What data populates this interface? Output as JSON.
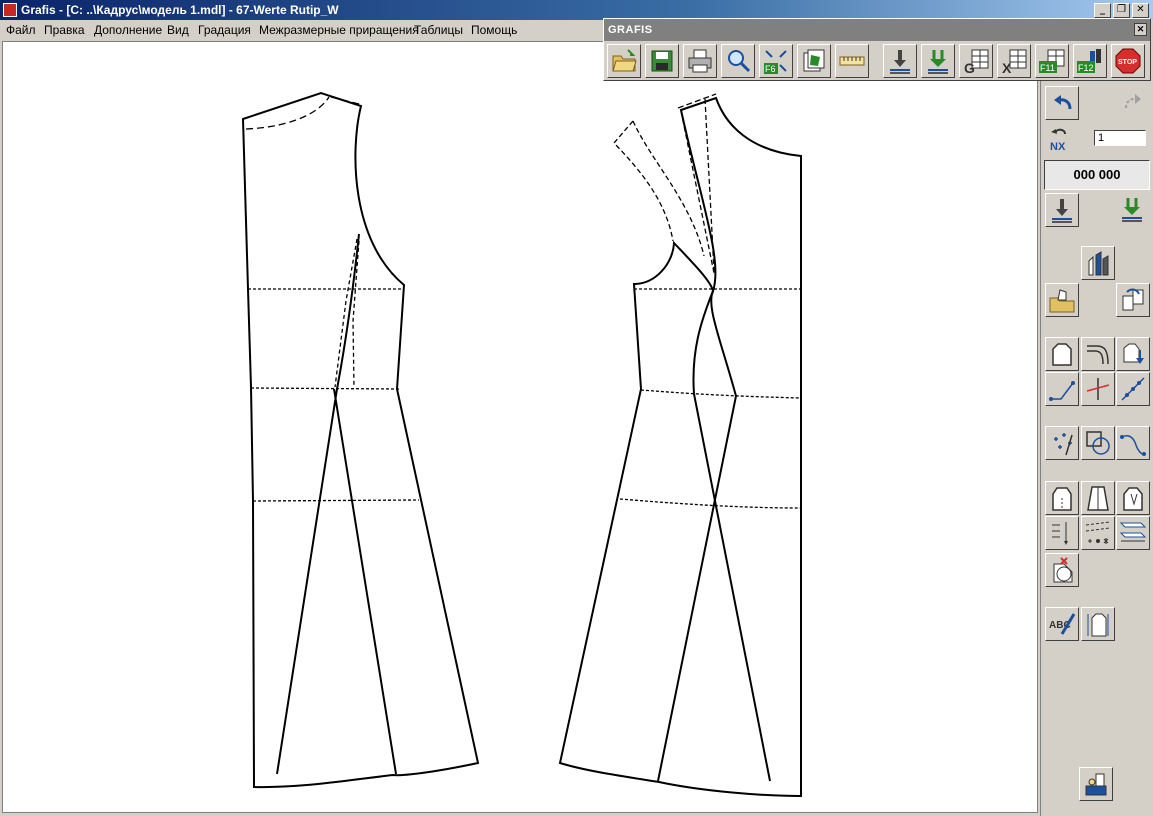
{
  "window": {
    "title": "Grafis - [C: ..\\Кадрус\\модель 1.mdl] - 67-Werte Rutip_W",
    "controls": {
      "minimize": "_",
      "restore": "❐",
      "close": "✕"
    }
  },
  "menu": {
    "items": [
      "Файл",
      "Правка",
      "Дополнение",
      "Вид",
      "Градация",
      "Межразмерные приращения",
      "Таблицы",
      "Помощь"
    ]
  },
  "toolbar": {
    "title": "GRAFIS",
    "close": "✕",
    "buttons": [
      "open-folder",
      "save",
      "print",
      "zoom",
      "f6-fit",
      "layers",
      "measure-tape",
      "down-arrow",
      "green-download",
      "g-table",
      "x-table",
      "f11",
      "f12",
      "stop"
    ],
    "f6_label": "F6",
    "f11_label": "F11",
    "f12_label": "F12",
    "stop_label": "STOP"
  },
  "right_panel": {
    "nx_value": "1",
    "counter": "000 000",
    "nx_label": "NX",
    "abc_label": "ABC"
  },
  "colors": {
    "titlebar": "#0a246a",
    "panel": "#d4d0c8",
    "canvas": "#ffffff",
    "pattern_line": "#000000"
  }
}
